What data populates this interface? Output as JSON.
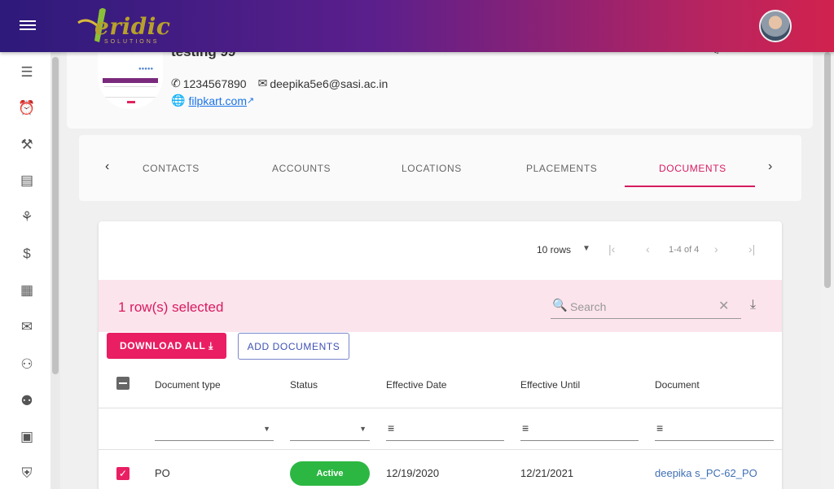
{
  "app": {
    "logo_text": "eridic",
    "logo_sub": "SOLUTIONS"
  },
  "profile": {
    "name": "testing 99",
    "phone": "1234567890",
    "email": "deepika5e6@sasi.ac.in",
    "website": "filpkart.com"
  },
  "tabs": {
    "items": [
      {
        "label": "CONTACTS"
      },
      {
        "label": "ACCOUNTS"
      },
      {
        "label": "LOCATIONS"
      },
      {
        "label": "PLACEMENTS"
      },
      {
        "label": "DOCUMENTS"
      }
    ],
    "active": "DOCUMENTS"
  },
  "pager": {
    "rows_label": "10 rows",
    "range": "1-4 of 4"
  },
  "selection": {
    "text": "1 row(s) selected"
  },
  "search": {
    "placeholder": "Search",
    "value": ""
  },
  "actions": {
    "download_all": "DOWNLOAD ALL",
    "add_documents": "ADD DOCUMENTS"
  },
  "table": {
    "columns": [
      "Document type",
      "Status",
      "Effective Date",
      "Effective Until",
      "Document"
    ],
    "rows": [
      {
        "document_type": "PO",
        "status": "Active",
        "effective_date": "12/19/2020",
        "effective_until": "12/21/2021",
        "document": "deepika s_PC-62_PO",
        "selected": true
      }
    ]
  },
  "colors": {
    "accent": "#e91e63",
    "active_status": "#2cb742",
    "selection_bg": "#fce4ec"
  }
}
